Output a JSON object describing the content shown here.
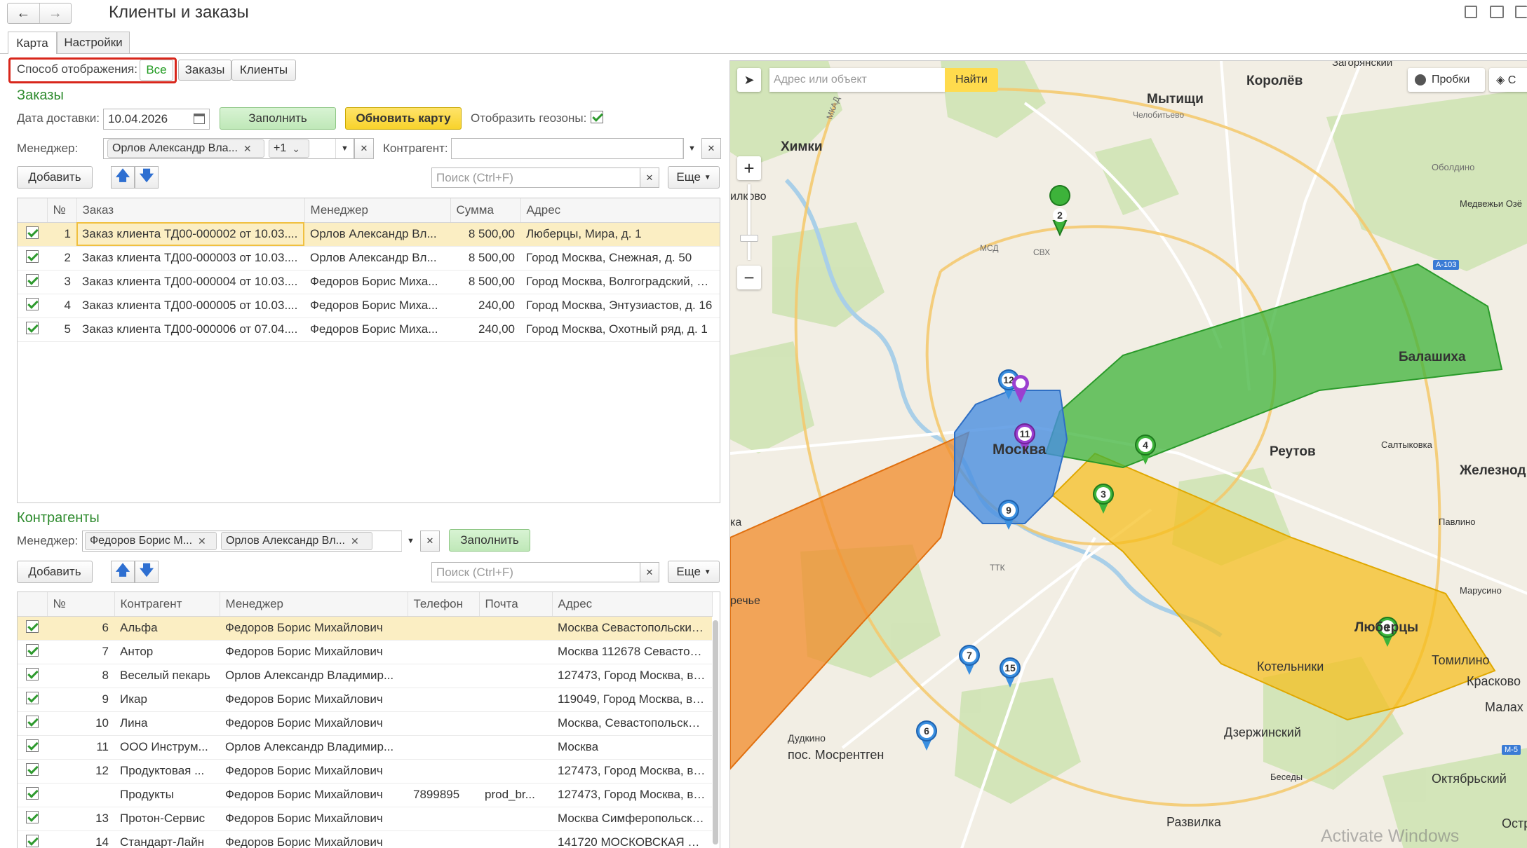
{
  "window": {
    "title": "Клиенты и заказы"
  },
  "tabs": [
    {
      "label": "Карта"
    },
    {
      "label": "Настройки"
    }
  ],
  "display_mode": {
    "label": "Способ отображения:",
    "options": [
      "Все",
      "Заказы",
      "Клиенты"
    ],
    "selected": "Все"
  },
  "orders": {
    "title": "Заказы",
    "delivery_label": "Дата доставки:",
    "delivery_date": "10.04.2026",
    "fill_label": "Заполнить",
    "refresh_map_label": "Обновить карту",
    "show_geozones_label": "Отобразить геозоны:",
    "manager_label": "Менеджер:",
    "manager_chip": "Орлов Александр Вла...",
    "manager_more": "+1",
    "counterparty_label": "Контрагент:",
    "add_label": "Добавить",
    "search_placeholder": "Поиск (Ctrl+F)",
    "more_label": "Еще",
    "columns": [
      "№",
      "Заказ",
      "Менеджер",
      "Сумма",
      "Адрес"
    ],
    "rows": [
      {
        "n": "1",
        "order": "Заказ клиента ТД00-000002 от 10.03....",
        "manager": "Орлов Александр Вл...",
        "sum": "8 500,00",
        "address": "Люберцы, Мира, д. 1"
      },
      {
        "n": "2",
        "order": "Заказ клиента ТД00-000003 от 10.03....",
        "manager": "Орлов Александр Вл...",
        "sum": "8 500,00",
        "address": "Город Москва, Снежная, д. 50"
      },
      {
        "n": "3",
        "order": "Заказ клиента ТД00-000004 от 10.03....",
        "manager": "Федоров Борис Миха...",
        "sum": "8 500,00",
        "address": "Город Москва, Волгоградский, д...."
      },
      {
        "n": "4",
        "order": "Заказ клиента ТД00-000005 от 10.03....",
        "manager": "Федоров Борис Миха...",
        "sum": "240,00",
        "address": "Город Москва, Энтузиастов, д. 16"
      },
      {
        "n": "5",
        "order": "Заказ клиента ТД00-000006 от 07.04....",
        "manager": "Федоров Борис Миха...",
        "sum": "240,00",
        "address": "Город Москва, Охотный ряд, д. 1"
      }
    ]
  },
  "counterparties": {
    "title": "Контрагенты",
    "manager_label": "Менеджер:",
    "manager_chips": [
      "Федоров Борис М...",
      "Орлов Александр Вл..."
    ],
    "fill_label": "Заполнить",
    "add_label": "Добавить",
    "search_placeholder": "Поиск (Ctrl+F)",
    "more_label": "Еще",
    "columns": [
      "№",
      "Контрагент",
      "Менеджер",
      "Телефон",
      "Почта",
      "Адрес"
    ],
    "rows": [
      {
        "n": "6",
        "name": "Альфа",
        "manager": "Федоров Борис Михайлович",
        "phone": "",
        "email": "",
        "address": "Москва Севастопольский п..."
      },
      {
        "n": "7",
        "name": "Антор",
        "manager": "Федоров Борис Михайлович",
        "phone": "",
        "email": "",
        "address": "Москва 112678 Севастопол..."
      },
      {
        "n": "8",
        "name": "Веселый пекарь",
        "manager": "Орлов Александр Владимир...",
        "phone": "",
        "email": "",
        "address": "127473, Город Москва, вн.т..."
      },
      {
        "n": "9",
        "name": "Икар",
        "manager": "Федоров Борис Михайлович",
        "phone": "",
        "email": "",
        "address": "119049, Город Москва, вн.т..."
      },
      {
        "n": "10",
        "name": "Лина",
        "manager": "Федоров Борис Михайлович",
        "phone": "",
        "email": "",
        "address": "Москва, Севастопольский п..."
      },
      {
        "n": "11",
        "name": "ООО Инструм...",
        "manager": "Орлов Александр Владимир...",
        "phone": "",
        "email": "",
        "address": "Москва"
      },
      {
        "n": "12",
        "name": "Продуктовая ...",
        "manager": "Федоров Борис Михайлович",
        "phone": "",
        "email": "",
        "address": "127473, Город Москва, вн.т..."
      },
      {
        "n": "",
        "name": "Продукты",
        "manager": "Федоров Борис Михайлович",
        "phone": "7899895",
        "email": "prod_br...",
        "address": "127473, Город Москва, вн.т..."
      },
      {
        "n": "13",
        "name": "Протон-Сервис",
        "manager": "Федоров Борис Михайлович",
        "phone": "",
        "email": "",
        "address": "Москва Симферопольский ..."
      },
      {
        "n": "14",
        "name": "Стандарт-Лайн",
        "manager": "Федоров Борис Михайлович",
        "phone": "",
        "email": "",
        "address": "141720 МОСКОВСКАЯ ОБЛ ..."
      }
    ]
  },
  "map": {
    "search_placeholder": "Адрес или объект",
    "find_label": "Найти",
    "traffic_label": "Пробки",
    "zoom_in": "+",
    "zoom_out": "−",
    "labels": {
      "korolev": "Королёв",
      "mytishchi": "Мытищи",
      "khimki": "Химки",
      "balashikha": "Балашиха",
      "moskva": "Москва",
      "reutov": "Реутов",
      "zheleznodor": "Железнод",
      "lyubertsy": "Люберцы",
      "kotelniki": "Котельники",
      "tomilino": "Томилино",
      "kraskovo": "Красково",
      "dzerzhinsky": "Дзержинский",
      "mosrentgen": "пос. Мосрентген",
      "oktyabrsky": "Октябрьский",
      "razvilka": "Развилка",
      "malakh": "Малах",
      "zagoryansky": "Загорянский",
      "ilkovo": "илково",
      "ostr": "Остр",
      "reche": "речье",
      "ka": "ка",
      "chelobitevo": "Челобитьево",
      "oboldino": "Оболдино",
      "medvezhi": "Медвежьи Озё",
      "saltykovka": "Салтыковка",
      "pavlino": "Павлино",
      "marusino": "Марусино",
      "dudkino": "Дудкино",
      "besedy": "Беседы",
      "a103": "А-103",
      "m5": "М-5",
      "mkad": "МКАД",
      "ttk": "ТТК",
      "svh": "СВХ",
      "msd": "МСД"
    },
    "pins": [
      "1",
      "2",
      "3",
      "4",
      "6",
      "7",
      "9",
      "11",
      "12",
      "15"
    ],
    "watermark": "Activate Windows"
  }
}
